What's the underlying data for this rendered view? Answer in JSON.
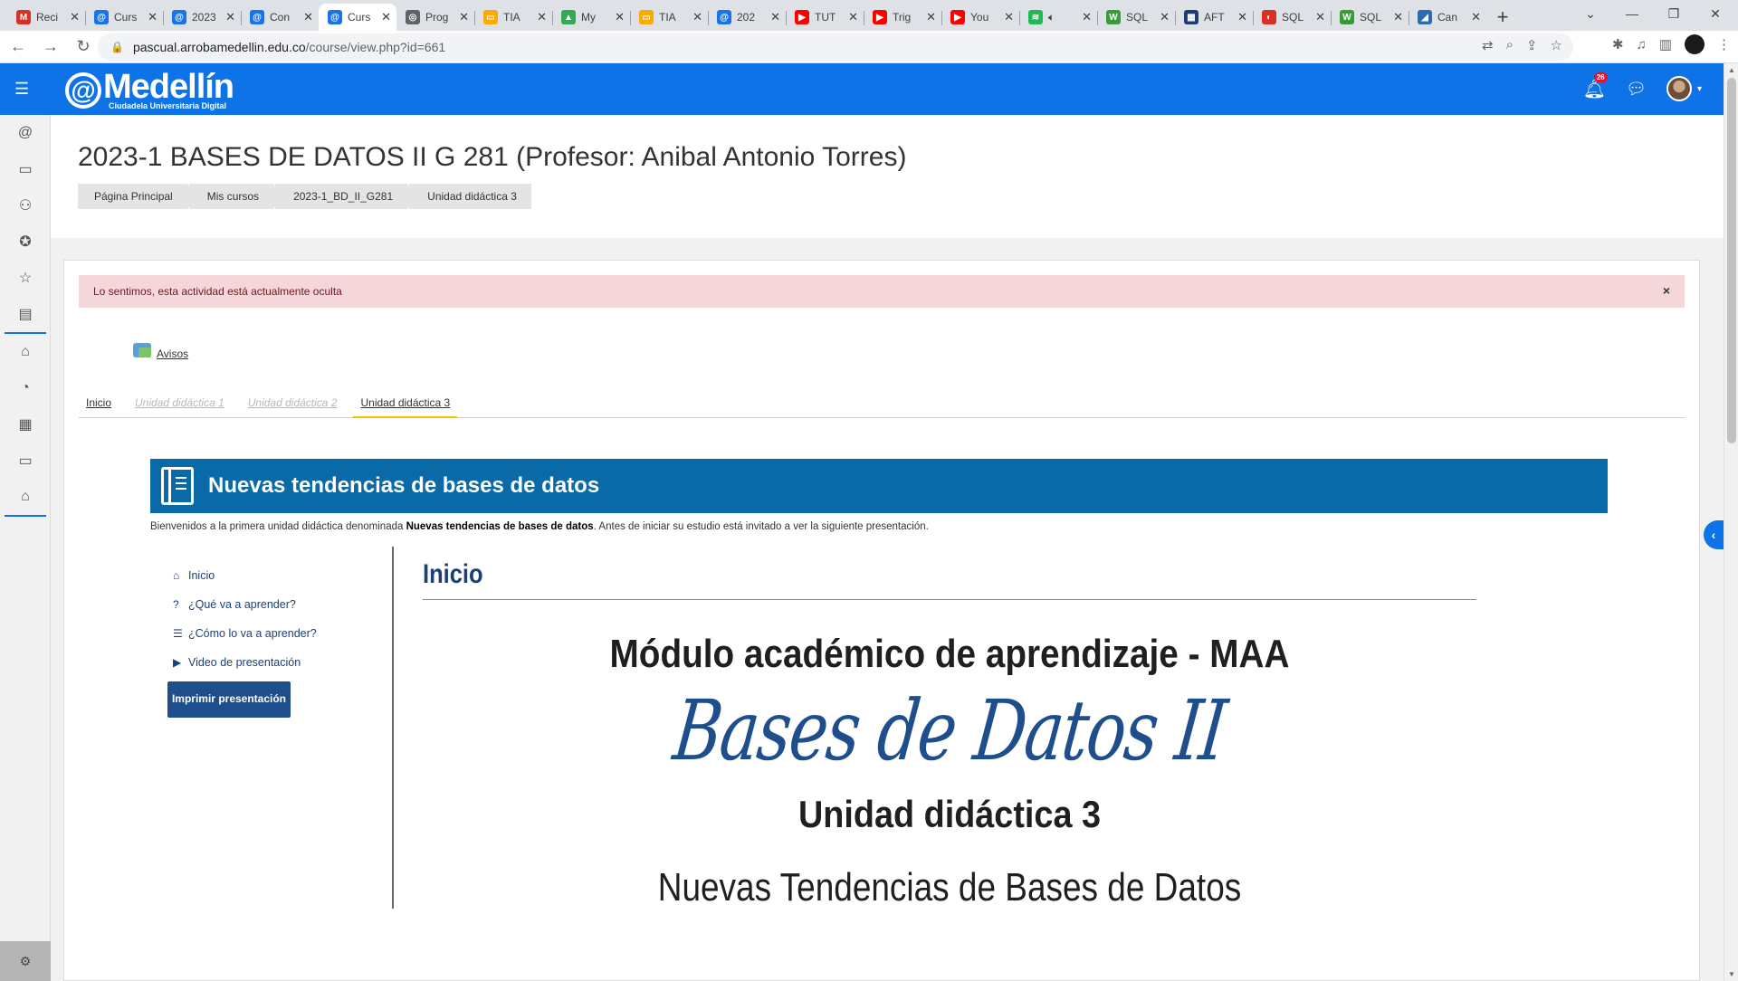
{
  "browser": {
    "tabs": [
      {
        "title": "Reci",
        "fav_color": "#d93025",
        "fav_glyph": "M"
      },
      {
        "title": "Curs",
        "fav_color": "#1a73e8",
        "fav_glyph": "@"
      },
      {
        "title": "2023",
        "fav_color": "#1a73e8",
        "fav_glyph": "@"
      },
      {
        "title": "Con",
        "fav_color": "#1a73e8",
        "fav_glyph": "@"
      },
      {
        "title": "Curs",
        "fav_color": "#1a73e8",
        "fav_glyph": "@",
        "active": true
      },
      {
        "title": "Prog",
        "fav_color": "#5f6368",
        "fav_glyph": "◎"
      },
      {
        "title": "TIA",
        "fav_color": "#f9ab00",
        "fav_glyph": "▭"
      },
      {
        "title": "My",
        "fav_color": "#34a853",
        "fav_glyph": "▲"
      },
      {
        "title": "TIA",
        "fav_color": "#f9ab00",
        "fav_glyph": "▭"
      },
      {
        "title": "202",
        "fav_color": "#1a73e8",
        "fav_glyph": "@"
      },
      {
        "title": "TUT",
        "fav_color": "#ff0000",
        "fav_glyph": "▶"
      },
      {
        "title": "Trig",
        "fav_color": "#ff0000",
        "fav_glyph": "▶"
      },
      {
        "title": "You",
        "fav_color": "#ff0000",
        "fav_glyph": "▶"
      },
      {
        "title": "",
        "fav_color": "#1db954",
        "fav_glyph": "≋",
        "audio": true
      },
      {
        "title": "SQL",
        "fav_color": "#3a9a3a",
        "fav_glyph": "W"
      },
      {
        "title": "AFT",
        "fav_color": "#1f3b73",
        "fav_glyph": "▦"
      },
      {
        "title": "SQL",
        "fav_color": "#d93025",
        "fav_glyph": "◐"
      },
      {
        "title": "SQL",
        "fav_color": "#3a9a3a",
        "fav_glyph": "W"
      },
      {
        "title": "Can",
        "fav_color": "#2b6cb0",
        "fav_glyph": "◢"
      }
    ],
    "url_host": "pascual.arrobamedellin.edu.co",
    "url_path": "/course/view.php?id=661"
  },
  "navbar": {
    "logo_name": "Medellín",
    "logo_at": "@",
    "logo_sub": "Ciudadela Universitaria Digital",
    "notification_count": "26",
    "accent": "#0d73e6"
  },
  "header": {
    "course_title": "2023-1 BASES DE DATOS II G 281 (Profesor: Anibal Antonio Torres)",
    "breadcrumb": [
      "Página Principal",
      "Mis cursos",
      "2023-1_BD_II_G281",
      "Unidad didáctica 3"
    ]
  },
  "alert": {
    "message": "Lo sentimos, esta actividad está actualmente oculta",
    "close": "×"
  },
  "avisos_label": "Avisos",
  "unit_tabs": [
    {
      "label": "Inicio",
      "state": "normal"
    },
    {
      "label": "Unidad didáctica 1",
      "state": "disabled"
    },
    {
      "label": "Unidad didáctica 2",
      "state": "disabled"
    },
    {
      "label": "Unidad didáctica 3",
      "state": "active"
    }
  ],
  "unit": {
    "title": "Nuevas tendencias de bases de datos",
    "intro_before": "Bienvenidos a la primera unidad didáctica denominada ",
    "intro_bold": "Nuevas tendencias de bases de datos",
    "intro_after": ". Antes de iniciar su estudio está invitado a ver la siguiente presentación."
  },
  "side_menu": {
    "items": [
      {
        "label": "Inicio",
        "icon": "home-icon",
        "glyph": "⌂"
      },
      {
        "label": "¿Qué va a aprender?",
        "icon": "question-circle-icon",
        "glyph": "?"
      },
      {
        "label": "¿Cómo lo va a aprender?",
        "icon": "list-icon",
        "glyph": "☰"
      },
      {
        "label": "Video de presentación",
        "icon": "youtube-icon",
        "glyph": "▶"
      }
    ],
    "print_button": "Imprimir presentación"
  },
  "presentation": {
    "heading": "Inicio",
    "module": "Módulo académico de aprendizaje - MAA",
    "script_title": "Bases de Datos II",
    "unit": "Unidad didáctica 3",
    "subtitle": "Nuevas Tendencias de Bases de Datos"
  }
}
